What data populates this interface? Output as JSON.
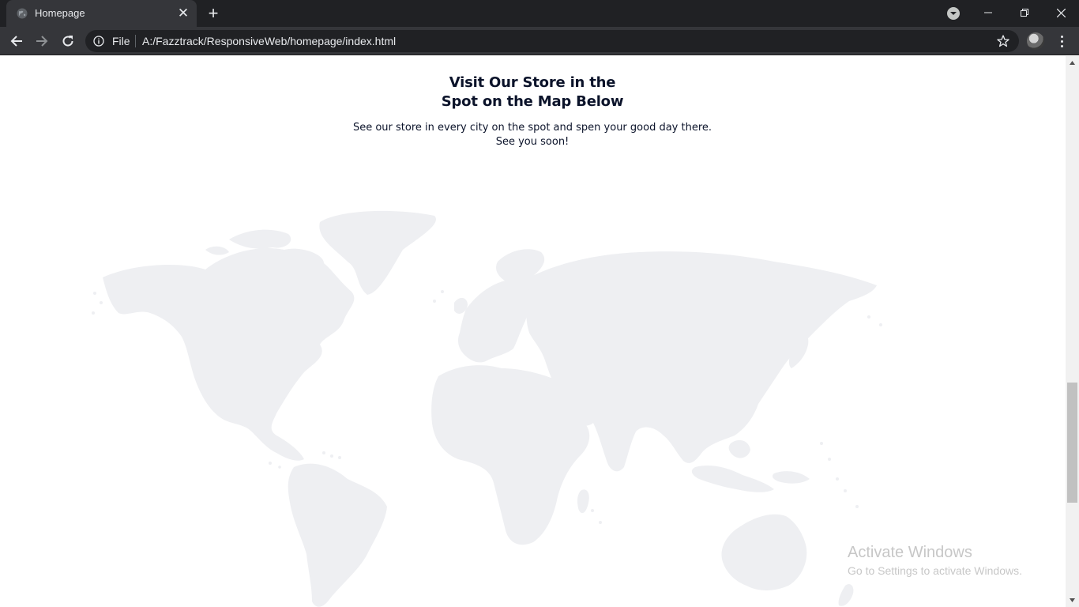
{
  "browser": {
    "tab": {
      "title": "Homepage",
      "favicon": "globe-icon"
    },
    "address_bar": {
      "scheme_label": "File",
      "url": "A:/Fazztrack/ResponsiveWeb/homepage/index.html"
    },
    "icons": {
      "back": "arrow-left-icon",
      "forward": "arrow-right-icon",
      "reload": "reload-icon",
      "info": "info-icon",
      "bookmark": "star-icon",
      "menu": "kebab-menu-icon",
      "new_tab": "plus-icon",
      "tab_search": "chevron-down-circle-icon"
    }
  },
  "page": {
    "heading_line1": "Visit Our Store in the",
    "heading_line2": "Spot on the Map Below",
    "subtext_line1": "See our store in every city on the spot and spen your good day there.",
    "subtext_line2": "See you soon!",
    "map_color": "#eeeff2",
    "text_color": "#0b132a"
  },
  "watermark": {
    "title": "Activate Windows",
    "subtitle": "Go to Settings to activate Windows."
  }
}
